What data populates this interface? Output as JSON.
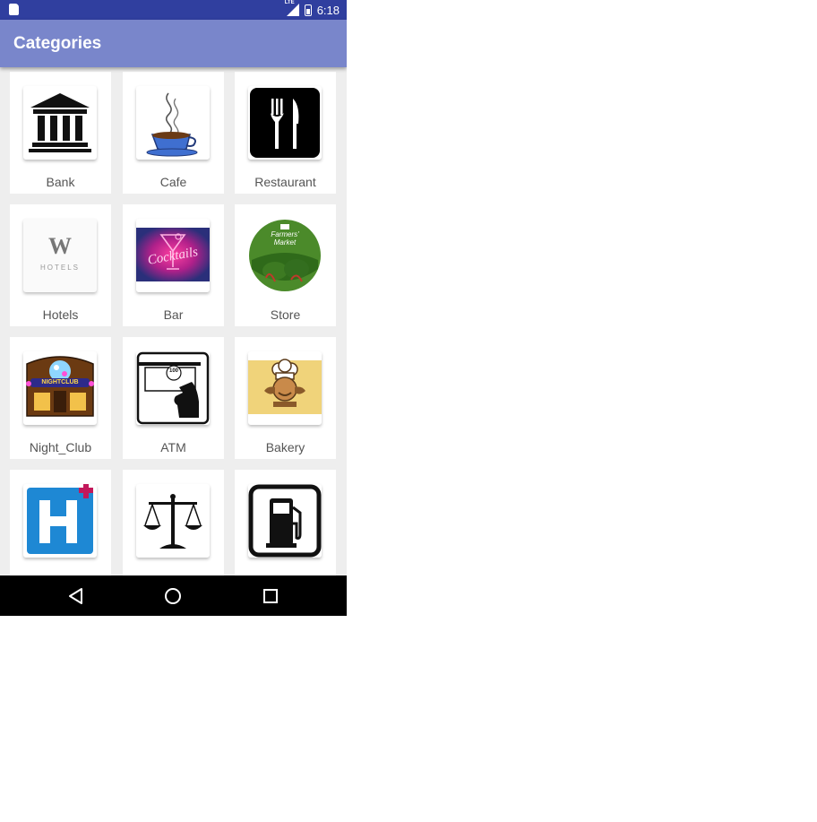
{
  "status_bar": {
    "network": "LTE",
    "time": "6:18"
  },
  "app_bar": {
    "title": "Categories"
  },
  "categories": [
    {
      "label": "Bank",
      "icon": "bank-icon"
    },
    {
      "label": "Cafe",
      "icon": "coffee-cup-icon"
    },
    {
      "label": "Restaurant",
      "icon": "fork-knife-icon"
    },
    {
      "label": "Hotels",
      "icon": "w-hotels-logo",
      "logo_text": "W",
      "logo_subtext": "HOTELS"
    },
    {
      "label": "Bar",
      "icon": "cocktail-icon",
      "logo_text": "Cocktails"
    },
    {
      "label": "Store",
      "icon": "farmers-market-icon",
      "logo_text": "Farmers' Market"
    },
    {
      "label": "Night_Club",
      "icon": "nightclub-icon",
      "logo_text": "NIGHTCLUB"
    },
    {
      "label": "ATM",
      "icon": "atm-icon",
      "logo_text": "100"
    },
    {
      "label": "Bakery",
      "icon": "chef-icon"
    },
    {
      "label": "",
      "icon": "hospital-icon"
    },
    {
      "label": "",
      "icon": "scales-of-justice-icon"
    },
    {
      "label": "",
      "icon": "gas-station-icon"
    }
  ],
  "colors": {
    "status_bar": "#303f9f",
    "app_bar": "#7986cb",
    "background": "#eeeeee",
    "hospital": "#1e88d4",
    "bar": "#2a2f7a"
  }
}
